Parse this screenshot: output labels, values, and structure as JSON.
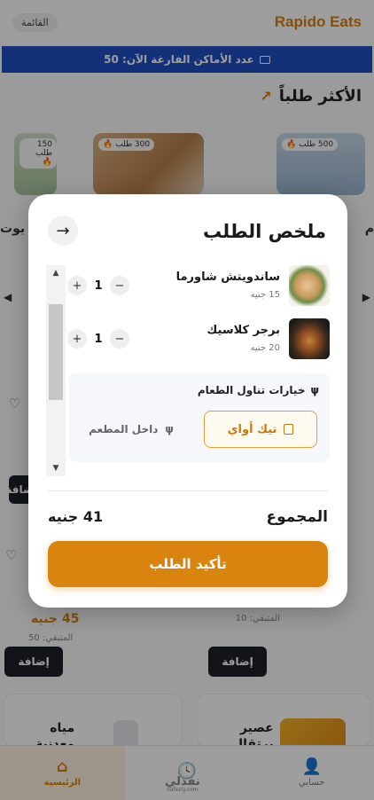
{
  "app": {
    "brand": "Rapido Eats",
    "menu_label": "القائمة"
  },
  "banner": {
    "text": "عدد الأماكن الفارغة الآن: 50",
    "icon": "envelope-icon"
  },
  "popular": {
    "title": "الأكثر طلباً",
    "icon": "trending-up-icon",
    "cards": [
      {
        "badge": "500 طلب 🔥"
      },
      {
        "badge": "300 طلب 🔥"
      },
      {
        "badge": "150 طلب 🔥"
      }
    ],
    "left_partial_name": "يوت",
    "right_partial_name": "م"
  },
  "grid": {
    "add_label": "إضافة",
    "price_left": "45 جنيه",
    "remain_left": "المتبقي: 50",
    "remain_right": "المتبقي: 10",
    "item_water": "مياه\nمعدنية",
    "item_juice": "عصير\nبرتقال"
  },
  "nav": {
    "home": "الرئيسية",
    "orders": "",
    "account": "حسابي"
  },
  "watermark": {
    "text": "نفذلي",
    "sub": "nafezly.com"
  },
  "modal": {
    "title": "ملخص الطلب",
    "close_icon": "arrow-right-icon",
    "items": [
      {
        "name": "ساندويتش شاورما",
        "price": "15 جنيه",
        "qty": "1"
      },
      {
        "name": "برجر كلاسيك",
        "price": "20 جنيه",
        "qty": "1"
      }
    ],
    "dining": {
      "title": "خيارات تناول الطعام",
      "options": [
        {
          "label": "تيك أواي",
          "selected": true
        },
        {
          "label": "داخل المطعم",
          "selected": false
        }
      ]
    },
    "total_label": "المجموع",
    "total_value": "41 جنيه",
    "confirm_label": "تأكيد الطلب"
  },
  "colors": {
    "accent": "#da8410",
    "banner": "#1f4fc2",
    "dark_button": "#1d2129"
  }
}
